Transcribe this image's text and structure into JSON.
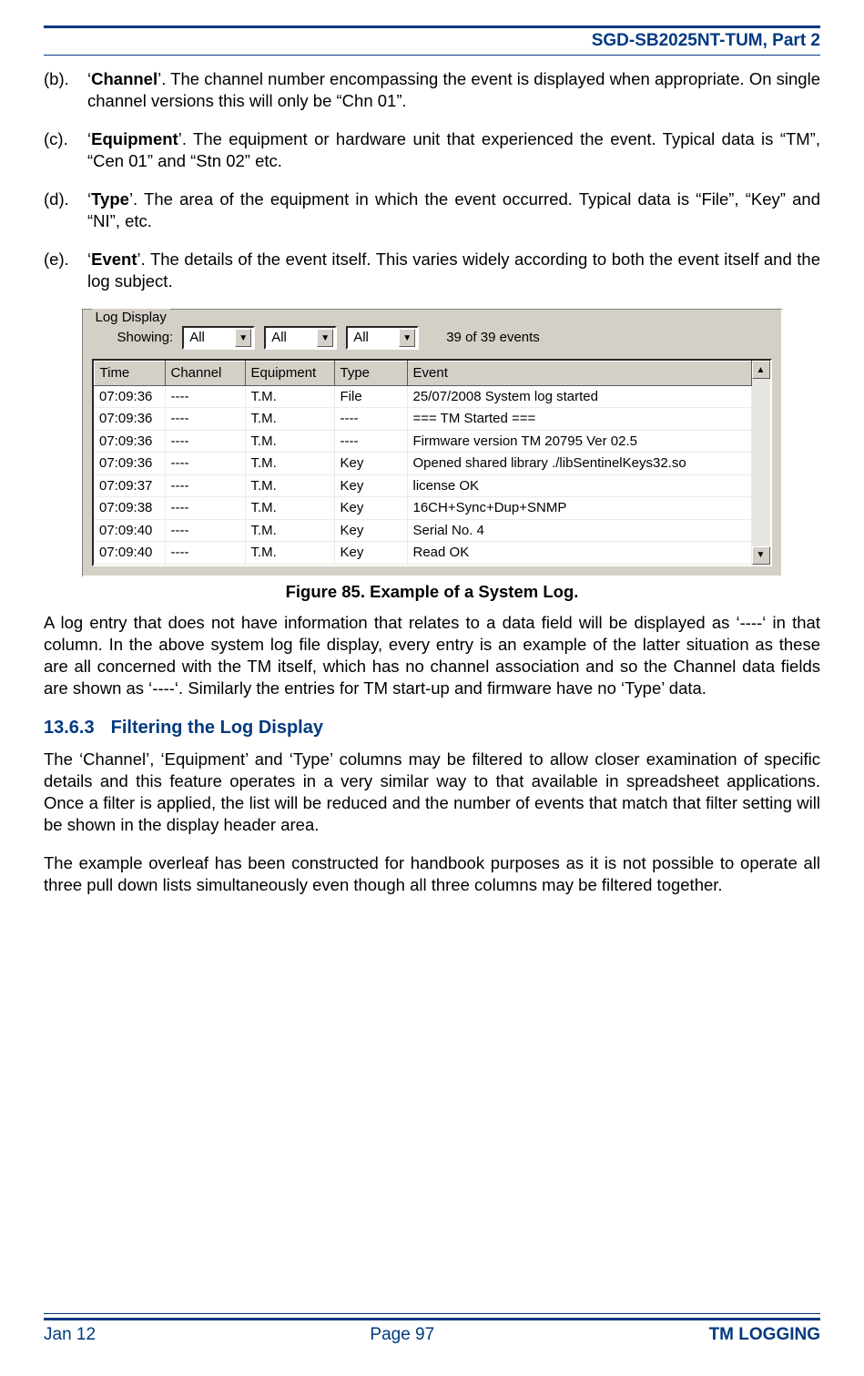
{
  "header": {
    "doc_code": "SGD-SB2025NT-TUM, Part 2"
  },
  "definitions": [
    {
      "marker": "(b).",
      "term": "Channel",
      "text": ".  The channel number encompassing the event is displayed when appropriate.  On single channel versions this will only be “Chn 01”."
    },
    {
      "marker": "(c).",
      "term": "Equipment",
      "text": ".   The equipment or hardware unit that experienced the event.   Typical data is “TM”, “Cen 01” and “Stn 02” etc."
    },
    {
      "marker": "(d).",
      "term": "Type",
      "text": ".   The area of the equipment in which the event occurred.   Typical data is “File”, “Key” and “NI”, etc."
    },
    {
      "marker": "(e).",
      "term": "Event",
      "text": ".   The details of the event itself.   This varies widely according to both the event itself and the log subject."
    }
  ],
  "log_window": {
    "legend": "Log Display",
    "showing_label": "Showing:",
    "filters": {
      "channel": "All",
      "equipment": "All",
      "type": "All"
    },
    "count_text": "39 of 39 events",
    "columns": [
      "Time",
      "Channel",
      "Equipment",
      "Type",
      "Event"
    ],
    "rows": [
      {
        "time": "07:09:36",
        "channel": "----",
        "equipment": "T.M.",
        "type": "File",
        "event": "25/07/2008 System log started"
      },
      {
        "time": "07:09:36",
        "channel": "----",
        "equipment": "T.M.",
        "type": "----",
        "event": "=== TM Started ==="
      },
      {
        "time": "07:09:36",
        "channel": "----",
        "equipment": "T.M.",
        "type": "----",
        "event": "Firmware version TM 20795 Ver 02.5"
      },
      {
        "time": "07:09:36",
        "channel": "----",
        "equipment": "T.M.",
        "type": "Key",
        "event": "Opened shared library ./libSentinelKeys32.so"
      },
      {
        "time": "07:09:37",
        "channel": "----",
        "equipment": "T.M.",
        "type": "Key",
        "event": "license OK"
      },
      {
        "time": "07:09:38",
        "channel": "----",
        "equipment": "T.M.",
        "type": "Key",
        "event": "16CH+Sync+Dup+SNMP"
      },
      {
        "time": "07:09:40",
        "channel": "----",
        "equipment": "T.M.",
        "type": "Key",
        "event": "Serial No. 4"
      },
      {
        "time": "07:09:40",
        "channel": "----",
        "equipment": "T.M.",
        "type": "Key",
        "event": "Read OK"
      }
    ]
  },
  "figure_caption": "Figure 85.  Example of a System Log.",
  "para_after_figure": "A log entry that does not have information that relates to a data field will be displayed as ‘----‘ in that column.  In the above system log file display, every entry is an example of the latter situation as  these  are  all  concerned  with  the  TM  itself,  which  has  no  channel  association  and  so  the Channel data fields are shown as ‘----‘.  Similarly the entries for TM start-up and firmware have no ‘Type’ data.",
  "section": {
    "number": "13.6.3",
    "title": "Filtering the Log Display"
  },
  "section_para1": "The  ‘Channel’,  ‘Equipment’  and  ‘Type’  columns  may  be  filtered  to  allow  closer  examination  of specific  details  and  this  feature  operates  in  a  very  similar  way  to  that  available  in  spreadsheet applications.  Once a filter is applied, the list will be reduced and the number of events that match that filter setting will be shown in the display header area.",
  "section_para2": "The example overleaf has been constructed for handbook purposes as it is not possible to operate all three pull down lists simultaneously even though all three columns may be filtered together.",
  "footer": {
    "left": "Jan 12",
    "center": "Page 97",
    "right": "TM LOGGING"
  }
}
